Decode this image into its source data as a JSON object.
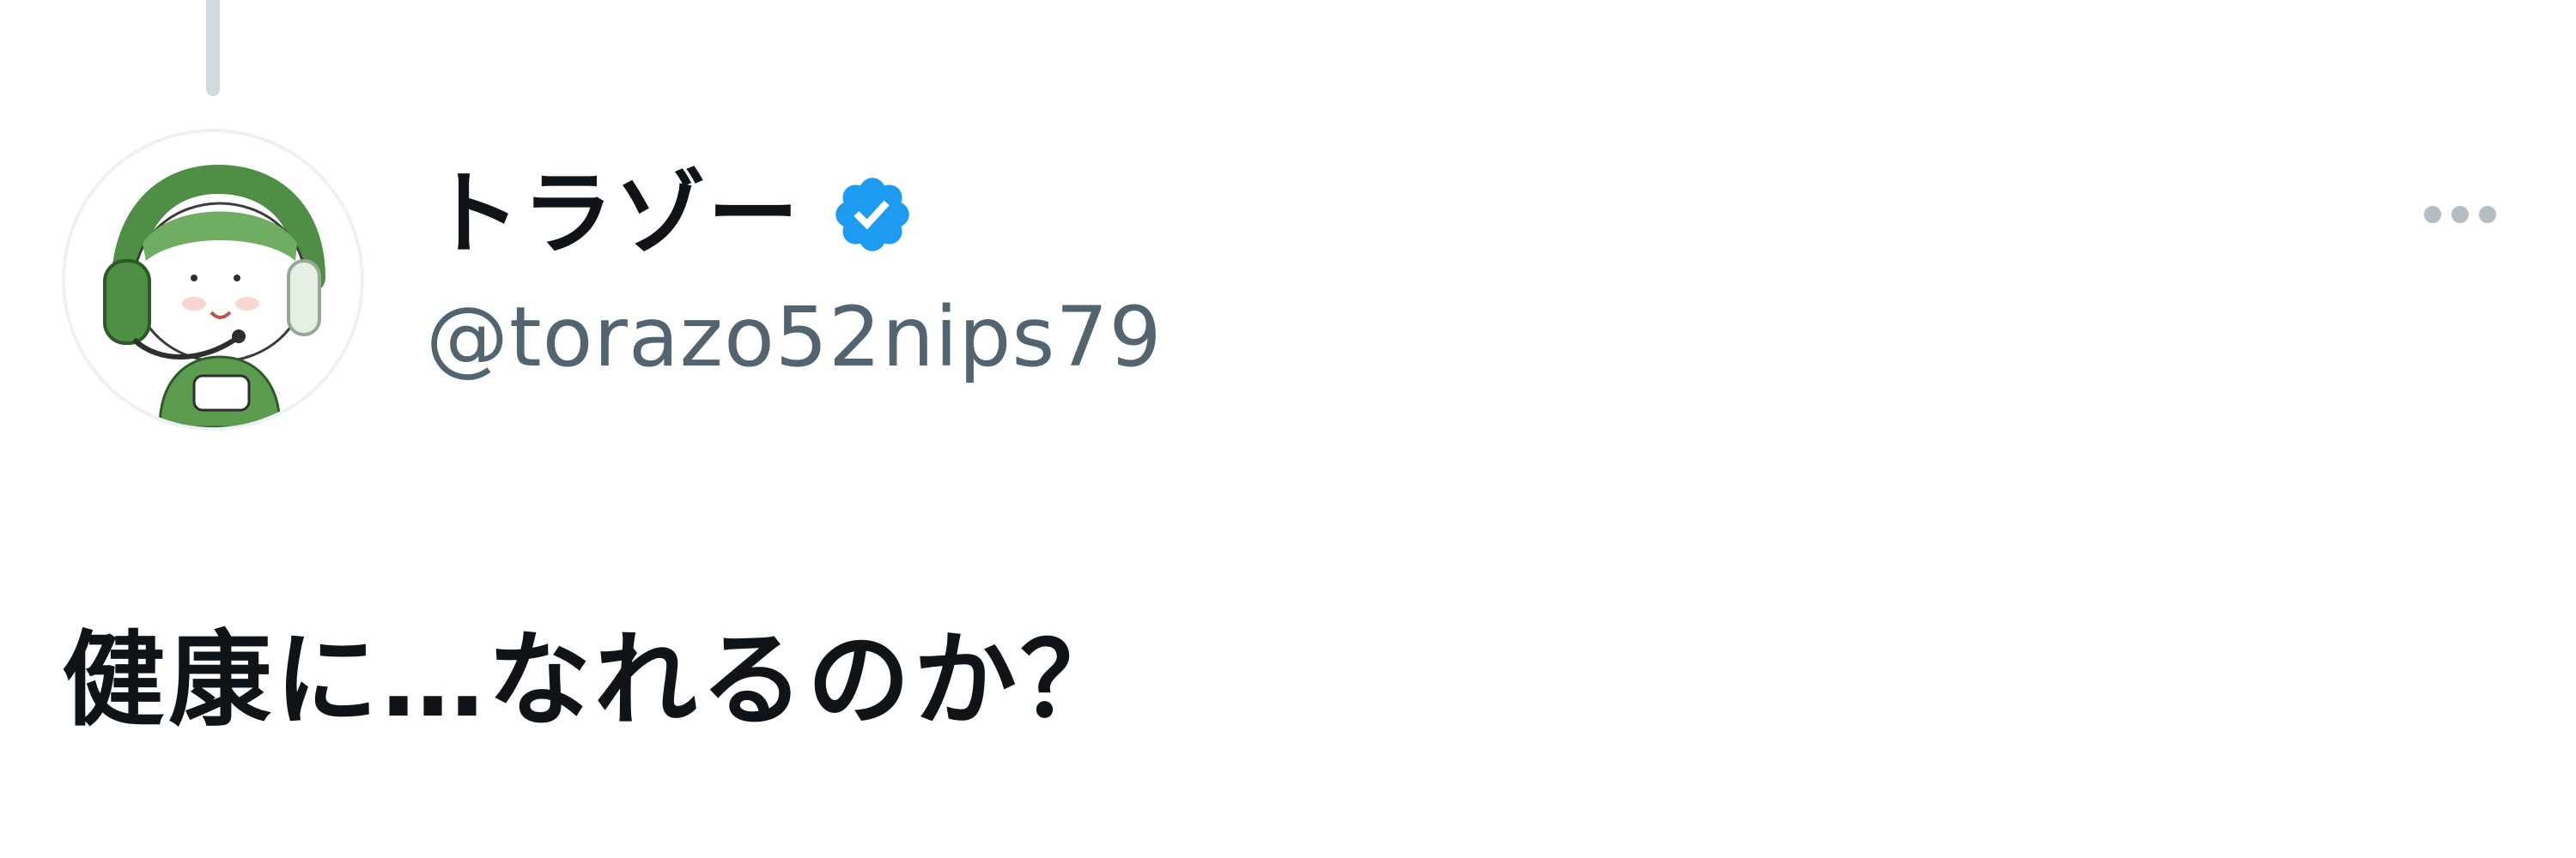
{
  "tweet": {
    "author": {
      "display_name": "トラゾー",
      "handle": "@torazo52nips79",
      "verified": true,
      "avatar_icon": "green-headset-character-avatar"
    },
    "text": "健康に…なれるのか？",
    "more_icon": "more-horizontal-icon"
  },
  "colors": {
    "text_primary": "#0f1419",
    "text_secondary": "#536471",
    "verified_blue": "#1d9bf0",
    "thread_line": "#cfd9de",
    "more_dots": "#b4bcc4",
    "avatar_green": "#4f8f45"
  }
}
